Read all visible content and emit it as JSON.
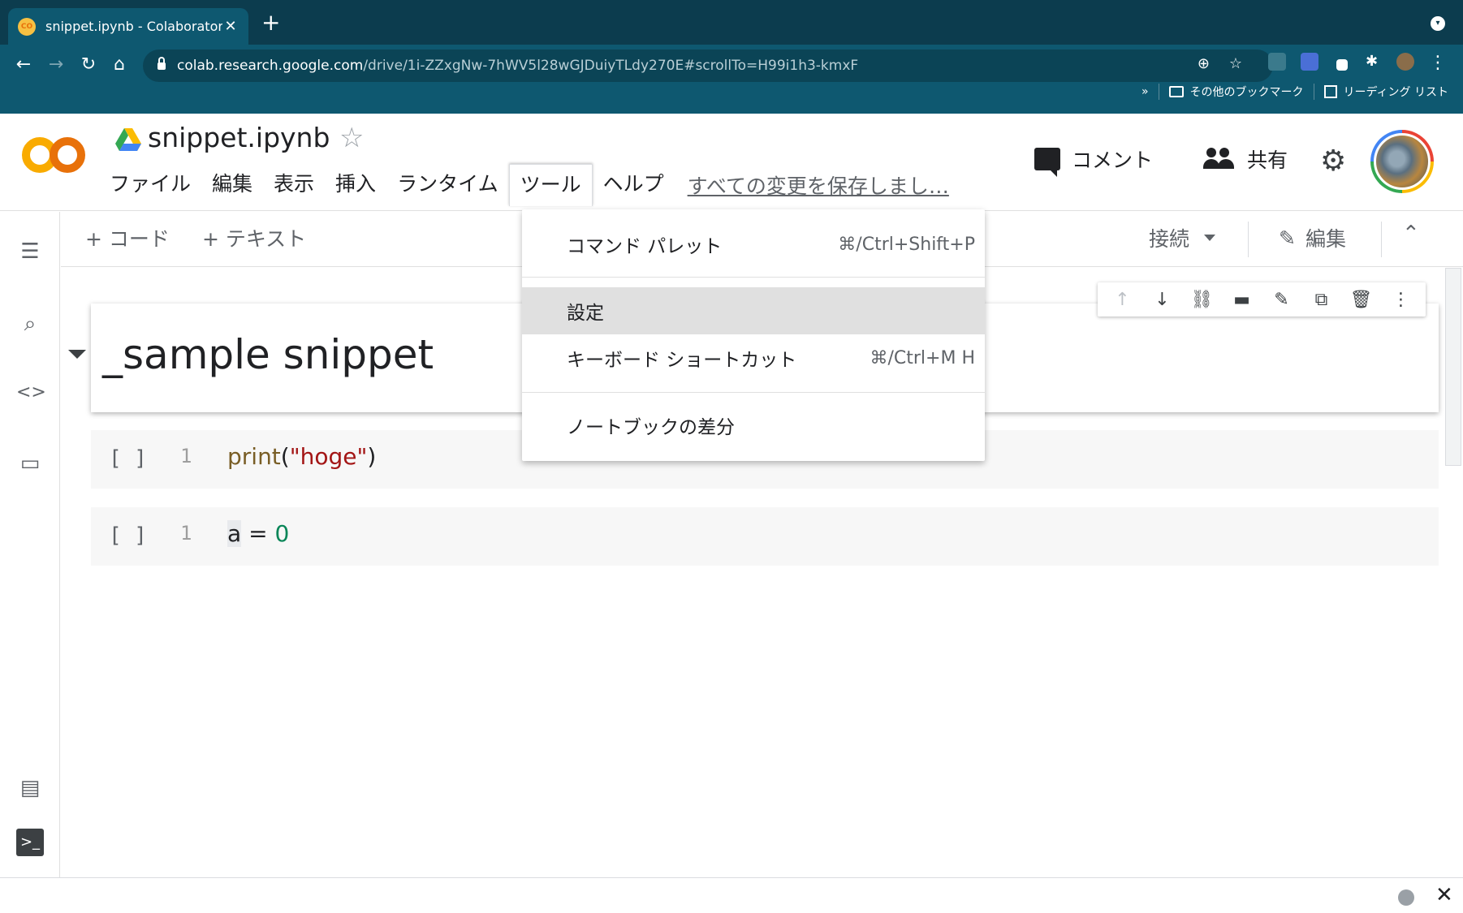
{
  "browser": {
    "tab_title": "snippet.ipynb - Colaboratory",
    "tab_favicon_text": "CO",
    "url_host": "colab.research.google.com",
    "url_path": "/drive/1i-ZZxgNw-7hWV5l28wGJDuiyTLdy270E#scrollTo=H99i1h3-kmxF",
    "bookmarks_overflow": "»",
    "bookmark_other": "その他のブックマーク",
    "bookmark_reading": "リーディング リスト"
  },
  "header": {
    "logo_text": "CO",
    "notebook_title": "snippet.ipynb",
    "menu": [
      "ファイル",
      "編集",
      "表示",
      "挿入",
      "ランタイム",
      "ツール",
      "ヘルプ"
    ],
    "save_status": "すべての変更を保存しまし…",
    "comment_label": "コメント",
    "share_label": "共有"
  },
  "toolbar": {
    "add_code": "+ コード",
    "add_text": "+ テキスト",
    "connect_label": "接続",
    "edit_label": "編集"
  },
  "cells": {
    "heading": "_sample snippet",
    "code1": {
      "bracket": "[ ]",
      "line": "1",
      "fn": "print",
      "open": "(",
      "str": "\"hoge\"",
      "close": ")"
    },
    "code2": {
      "bracket": "[ ]",
      "line": "1",
      "var": "a",
      "op": " = ",
      "num": "0"
    }
  },
  "dropdown": {
    "items": [
      {
        "label": "コマンド パレット",
        "shortcut": "⌘/Ctrl+Shift+P"
      },
      {
        "label": "設定",
        "shortcut": ""
      },
      {
        "label": "キーボード ショートカット",
        "shortcut": "⌘/Ctrl+M H"
      },
      {
        "label": "ノートブックの差分",
        "shortcut": ""
      }
    ],
    "highlighted_index": 1
  },
  "colors": {
    "chrome_dark": "#0c3c4e",
    "chrome_toolbar": "#0e5870",
    "colab_orange": "#f9ab00",
    "highlight": "#e0e0e0"
  }
}
